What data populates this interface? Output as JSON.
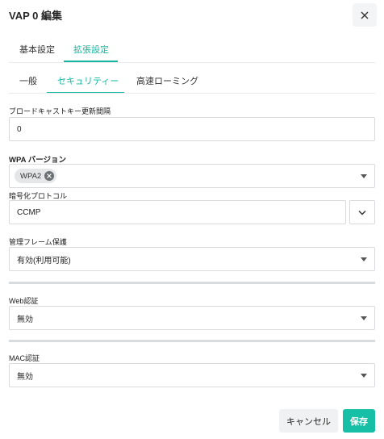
{
  "dialog": {
    "title": "VAP 0 編集"
  },
  "tabs": [
    {
      "label": "基本設定",
      "active": false
    },
    {
      "label": "拡張設定",
      "active": true
    }
  ],
  "subtabs": [
    {
      "label": "一般",
      "active": false
    },
    {
      "label": "セキュリティー",
      "active": true
    },
    {
      "label": "高速ローミング",
      "active": false
    }
  ],
  "fields": {
    "broadcast_key": {
      "label": "ブロードキャストキー更新間隔",
      "value": "0"
    },
    "wpa_version": {
      "label": "WPA バージョン",
      "chip": "WPA2"
    },
    "encryption": {
      "label": "暗号化プロトコル",
      "value": "CCMP"
    },
    "mgmt_frame": {
      "label": "管理フレーム保護",
      "value": "有効(利用可能)"
    },
    "web_auth": {
      "label": "Web認証",
      "value": "無効"
    },
    "mac_auth": {
      "label": "MAC認証",
      "value": "無効"
    }
  },
  "buttons": {
    "cancel": "キャンセル",
    "save": "保存"
  },
  "colors": {
    "accent": "#14b8a2",
    "save": "#17bfa6"
  }
}
